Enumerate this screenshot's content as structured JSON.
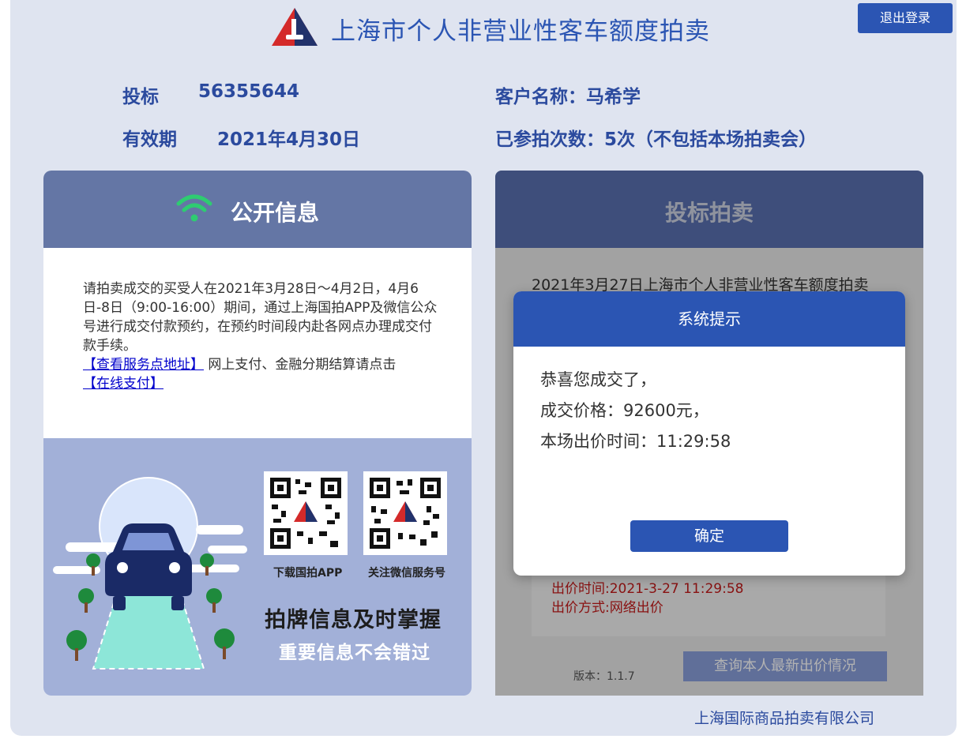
{
  "header": {
    "title": "上海市个人非营业性客车额度拍卖",
    "logout_label": "退出登录"
  },
  "info": {
    "bid_label": "投标",
    "bid_number": "56355644",
    "validity_label": "有效期",
    "validity_date": "2021年4月30日",
    "customer_name": "客户名称：马希学",
    "participation": "已参拍次数：5次（不包括本场拍卖会）"
  },
  "public_info": {
    "title": "公开信息",
    "notice_text": "请拍卖成交的买受人在2021年3月28日～4月2日，4月6日-8日（9:00-16:00）期间，通过上海国拍APP及微信公众号进行成交付款预约，在预约时间段内赴各网点办理成交付款手续。",
    "link_service": "【查看服务点地址】",
    "payment_text": " 网上支付、金融分期结算请点击",
    "link_payment": "【在线支付】",
    "qr_app_label": "下载国拍APP",
    "qr_wechat_label": "关注微信服务号",
    "slogan_main": "拍牌信息及时掌握",
    "slogan_sub": "重要信息不会错过"
  },
  "bidding": {
    "title": "投标拍卖",
    "auction_text": "2021年3月27日上海市个人非营业性客车额度拍卖",
    "bid_time": "出价时间:2021-3-27 11:29:58",
    "bid_method": "出价方式:网络出价",
    "version": "版本：1.1.7",
    "query_button": "查询本人最新出价情况"
  },
  "dialog": {
    "title": "系统提示",
    "line1": "恭喜您成交了，",
    "line2": "成交价格：92600元，",
    "line3": "本场出价时间：11:29:58",
    "confirm_label": "确定"
  },
  "footer": {
    "company": "上海国际商品拍卖有限公司"
  },
  "colors": {
    "primary": "#2b55b3",
    "panel_header_left": "#6476a5",
    "panel_header_right": "#5a70b0",
    "background": "#dfe4f0",
    "wifi": "#2ecc71",
    "bid_red": "#c41a1a"
  },
  "icons": {
    "logo": "auction-logo-icon",
    "wifi": "wifi-icon",
    "car": "car-illustration",
    "qr": "qr-code-icon"
  }
}
